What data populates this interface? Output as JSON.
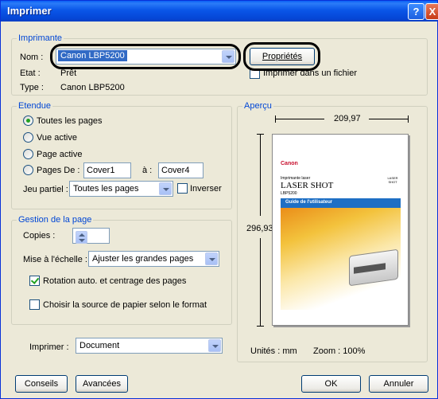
{
  "window": {
    "title": "Imprimer",
    "help": "?",
    "close": "X"
  },
  "printer": {
    "group_title": "Imprimante",
    "name_label": "Nom :",
    "name_value": "Canon LBP5200",
    "properties_label": "Propriétés",
    "status_label": "Etat :",
    "status_value": "Prêt",
    "type_label": "Type :",
    "type_value": "Canon LBP5200",
    "print_to_file_label": "Imprimer dans un fichier",
    "print_to_file_checked": false
  },
  "range": {
    "group_title": "Etendue",
    "all_pages": "Toutes les pages",
    "current_view": "Vue active",
    "current_page": "Page active",
    "pages_label": "Pages De :",
    "pages_from": "Cover1",
    "pages_to_label": "à :",
    "pages_to": "Cover4",
    "subset_label": "Jeu partiel :",
    "subset_value": "Toutes les pages",
    "reverse_label": "Inverser",
    "reverse_checked": false,
    "selected": "Toutes les pages"
  },
  "page_handling": {
    "group_title": "Gestion de la page",
    "copies_label": "Copies :",
    "copies_value": "1",
    "scaling_label": "Mise à l'échelle :",
    "scaling_value": "Ajuster les grandes pages",
    "autorotate_label": "Rotation auto. et centrage des pages",
    "autorotate_checked": true,
    "paper_source_label": "Choisir la source de papier selon le format",
    "paper_source_checked": false
  },
  "print_what": {
    "label": "Imprimer :",
    "value": "Document"
  },
  "preview": {
    "group_title": "Aperçu",
    "width": "209,97",
    "height": "296,93",
    "units": "Unités : mm",
    "zoom": "Zoom : 100%",
    "doc_brand": "Canon",
    "doc_subtitle": "Imprimante laser",
    "doc_title": "LASER SHOT",
    "doc_model": "LBP5200",
    "doc_guide": "Guide de l'utilisateur",
    "doc_logo": "LASER SHOT"
  },
  "buttons": {
    "tips": "Conseils",
    "advanced": "Avancées",
    "ok": "OK",
    "cancel": "Annuler"
  },
  "colors": {
    "accent": "#0046d5",
    "titlebar": "#0a56e8",
    "highlight": "#000000"
  }
}
